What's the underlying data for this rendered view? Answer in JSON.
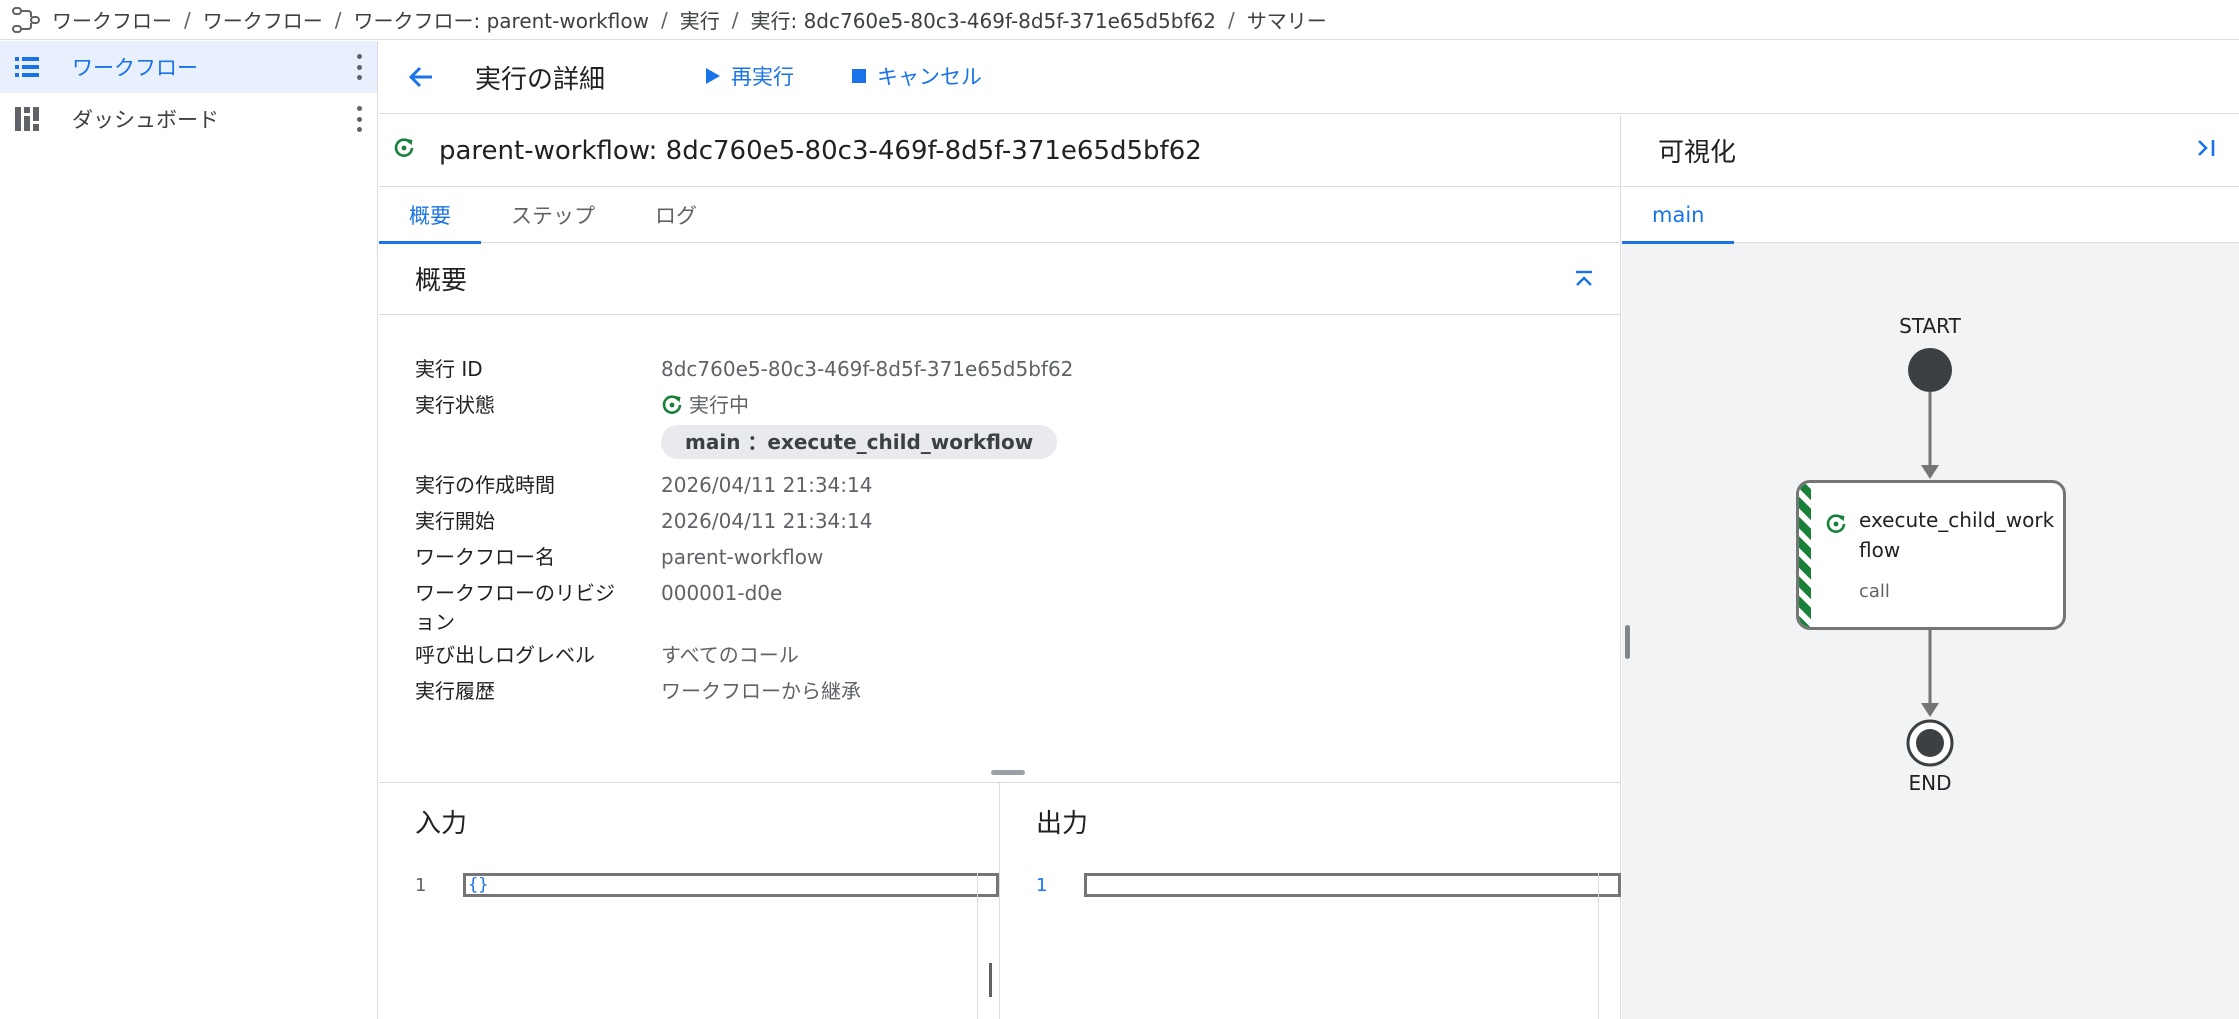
{
  "breadcrumb": {
    "items": [
      "ワークフロー",
      "ワークフロー",
      "ワークフロー: parent-workflow",
      "実行",
      "実行: 8dc760e5-80c3-469f-8d5f-371e65d5bf62",
      "サマリー"
    ],
    "separator": "/"
  },
  "sidebar": {
    "items": [
      {
        "label": "ワークフロー",
        "icon": "list-icon",
        "active": true
      },
      {
        "label": "ダッシュボード",
        "icon": "dashboard-icon",
        "active": false
      }
    ]
  },
  "header": {
    "title": "実行の詳細",
    "rerun_label": "再実行",
    "cancel_label": "キャンセル"
  },
  "execution": {
    "title": "parent-workflow: 8dc760e5-80c3-469f-8d5f-371e65d5bf62",
    "tabs": [
      "概要",
      "ステップ",
      "ログ"
    ],
    "section_title": "概要",
    "details": {
      "exec_id_label": "実行 ID",
      "exec_id": "8dc760e5-80c3-469f-8d5f-371e65d5bf62",
      "state_label": "実行状態",
      "state": "実行中",
      "current_step_chip": "main ：execute_child_workflow",
      "created_label": "実行の作成時間",
      "created": "2026/04/11 21:34:14",
      "started_label": "実行開始",
      "started": "2026/04/11 21:34:14",
      "workflow_name_label": "ワークフロー名",
      "workflow_name": "parent-workflow",
      "revision_label_line1": "ワークフローのリビジ",
      "revision_label_line2": "ョン",
      "revision": "000001-d0e",
      "call_log_label": "呼び出しログレベル",
      "call_log": "すべてのコール",
      "history_label": "実行履歴",
      "history": "ワークフローから継承"
    },
    "input": {
      "title": "入力",
      "line": "1",
      "code": "{}"
    },
    "output": {
      "title": "出力",
      "line": "1",
      "code": ""
    }
  },
  "visualization": {
    "title": "可視化",
    "tab": "main",
    "start_label": "START",
    "end_label": "END",
    "step_name": "execute_child_workflow",
    "step_type": "call"
  },
  "colors": {
    "accent": "#1a73e8",
    "running": "#188038"
  }
}
